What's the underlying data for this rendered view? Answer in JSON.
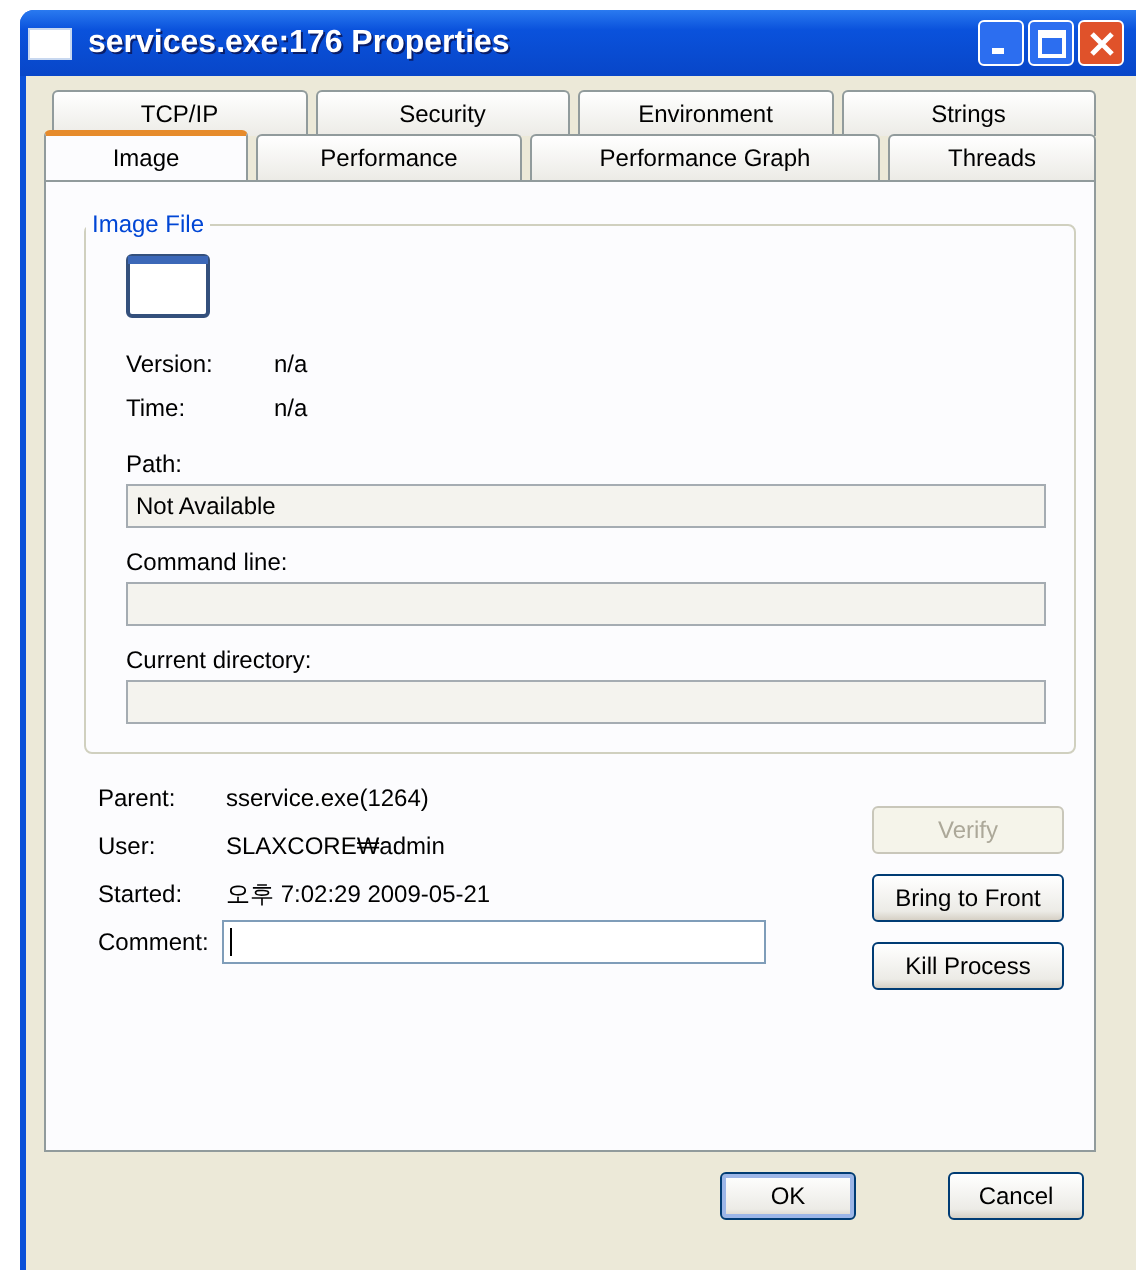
{
  "window": {
    "title": "services.exe:176 Properties",
    "controls": [
      {
        "kind": "minimize"
      },
      {
        "kind": "maximize"
      },
      {
        "kind": "close"
      }
    ]
  },
  "tab_rows": [
    [
      {
        "label": "TCP/IP",
        "selected": false
      },
      {
        "label": "Security",
        "selected": false
      },
      {
        "label": "Environment",
        "selected": false
      },
      {
        "label": "Strings",
        "selected": false
      }
    ],
    [
      {
        "label": "Image",
        "selected": true
      },
      {
        "label": "Performance",
        "selected": false
      },
      {
        "label": "Performance Graph",
        "selected": false
      },
      {
        "label": "Threads",
        "selected": false
      }
    ]
  ],
  "image_file": {
    "title": "Image File",
    "info": [
      {
        "label": "Version:",
        "value": "n/a"
      },
      {
        "label": "Time:",
        "value": "n/a"
      }
    ],
    "fields": [
      {
        "label": "Path:",
        "value": "Not Available"
      },
      {
        "label": "Command line:"
      },
      {
        "label": "Current directory:"
      }
    ]
  },
  "process": {
    "info": [
      {
        "label": "Parent:",
        "value": "sservice.exe(1264)"
      },
      {
        "label": "User:",
        "value": "SLAXCORE₩admin"
      },
      {
        "label": "Started:",
        "value": "오후 7:02:29   2009-05-21"
      }
    ],
    "comment": {
      "label": "Comment:",
      "focused": true
    }
  },
  "side_buttons": [
    {
      "label": "Verify",
      "disabled": true
    },
    {
      "label": "Bring to Front",
      "disabled": false
    },
    {
      "label": "Kill Process",
      "disabled": false
    }
  ],
  "dialog_buttons": [
    {
      "label": "OK",
      "default": true
    },
    {
      "label": "Cancel",
      "default": false
    }
  ]
}
